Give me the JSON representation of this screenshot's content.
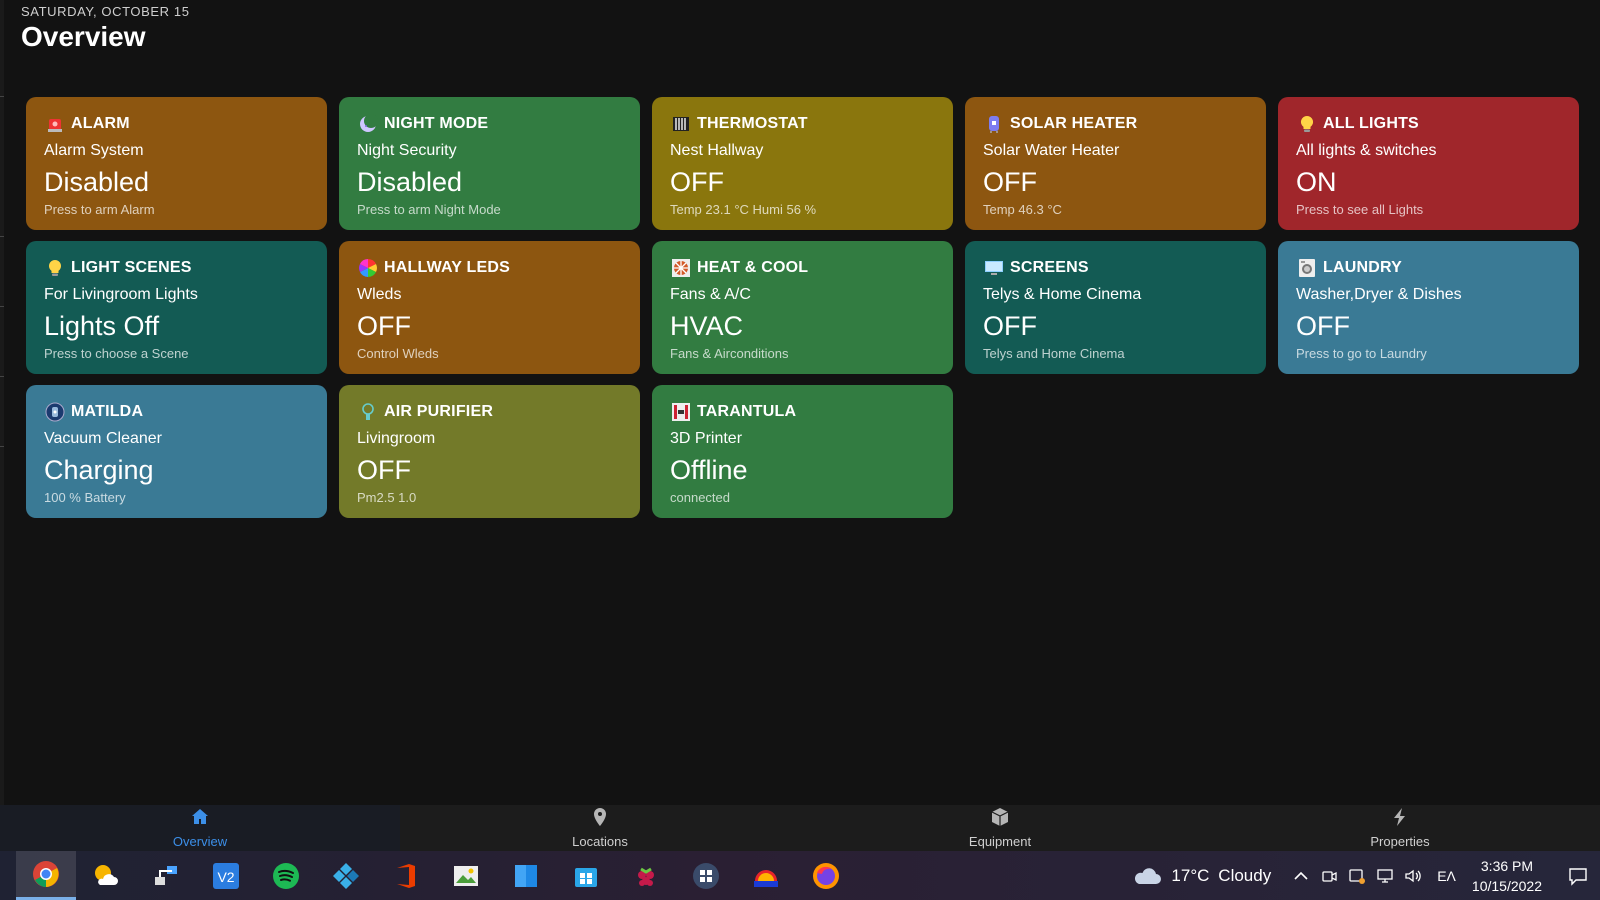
{
  "header": {
    "date": "SATURDAY, OCTOBER 15",
    "title": "Overview"
  },
  "cards": [
    {
      "id": "alarm",
      "color": "#8d5610",
      "icon": "alarm-icon",
      "name": "ALARM",
      "subtitle": "Alarm System",
      "state": "Disabled",
      "note": "Press to arm Alarm"
    },
    {
      "id": "night-mode",
      "color": "#327c41",
      "icon": "moon-icon",
      "name": "NIGHT MODE",
      "subtitle": "Night Security",
      "state": "Disabled",
      "note": "Press to arm Night Mode"
    },
    {
      "id": "thermostat",
      "color": "#8a760d",
      "icon": "radiator-icon",
      "name": "THERMOSTAT",
      "subtitle": "Nest Hallway",
      "state": "OFF",
      "note": "Temp 23.1 °C Humi 56 %"
    },
    {
      "id": "solar-heater",
      "color": "#8d5610",
      "icon": "water-heater-icon",
      "name": "SOLAR HEATER",
      "subtitle": "Solar Water Heater",
      "state": "OFF",
      "note": "Temp 46.3 °C"
    },
    {
      "id": "all-lights",
      "color": "#a0262b",
      "icon": "bulb-icon",
      "name": "ALL LIGHTS",
      "subtitle": "All lights & switches",
      "state": "ON",
      "note": "Press to see all Lights"
    },
    {
      "id": "light-scenes",
      "color": "#135b54",
      "icon": "bulb-icon",
      "name": "LIGHT SCENES",
      "subtitle": "For Livingroom Lights",
      "state": "Lights Off",
      "note": "Press to choose a Scene"
    },
    {
      "id": "hallway-leds",
      "color": "#8d5610",
      "icon": "color-wheel-icon",
      "name": "HALLWAY LEDS",
      "subtitle": "Wleds",
      "state": "OFF",
      "note": "Control Wleds"
    },
    {
      "id": "heat-cool",
      "color": "#327c41",
      "icon": "fan-icon",
      "name": "HEAT & COOL",
      "subtitle": "Fans & A/C",
      "state": "HVAC",
      "note": "Fans & Airconditions"
    },
    {
      "id": "screens",
      "color": "#135b54",
      "icon": "monitor-icon",
      "name": "SCREENS",
      "subtitle": "Telys & Home Cinema",
      "state": "OFF",
      "note": "Telys and Home Cinema"
    },
    {
      "id": "laundry",
      "color": "#3a7a95",
      "icon": "washer-icon",
      "name": "LAUNDRY",
      "subtitle": "Washer,Dryer & Dishes",
      "state": "OFF",
      "note": "Press to go to Laundry"
    },
    {
      "id": "matilda",
      "color": "#3a7a95",
      "icon": "robot-vacuum-icon",
      "name": "MATILDA",
      "subtitle": "Vacuum Cleaner",
      "state": "Charging",
      "note": "100 % Battery"
    },
    {
      "id": "air-purifier",
      "color": "#737a29",
      "icon": "air-purifier-icon",
      "name": "AIR PURIFIER",
      "subtitle": "Livingroom",
      "state": "OFF",
      "note": "Pm2.5 1.0"
    },
    {
      "id": "tarantula",
      "color": "#327c41",
      "icon": "printer-3d-icon",
      "name": "TARANTULA",
      "subtitle": "3D Printer",
      "state": "Offline",
      "note": "connected"
    }
  ],
  "nav": [
    {
      "id": "overview",
      "label": "Overview",
      "icon": "home-icon",
      "active": true
    },
    {
      "id": "locations",
      "label": "Locations",
      "icon": "map-pin-icon",
      "active": false
    },
    {
      "id": "equipment",
      "label": "Equipment",
      "icon": "box-icon",
      "active": false
    },
    {
      "id": "properties",
      "label": "Properties",
      "icon": "lightning-icon",
      "active": false
    }
  ],
  "taskbar": {
    "apps": [
      "chrome-icon",
      "weather-app-icon",
      "network-tool-icon",
      "vnc-viewer-icon",
      "spotify-icon",
      "kodi-icon",
      "office-icon",
      "image-viewer-icon",
      "file-manager-icon",
      "store-icon",
      "raspberry-pi-icon",
      "media-server-icon",
      "vpn-icon",
      "firefox-icon"
    ],
    "weather": {
      "temp": "17°C",
      "condition": "Cloudy"
    },
    "lang": "ΕΛ",
    "time": "3:36 PM",
    "date": "10/15/2022"
  },
  "colors": {
    "accent": "#3c8fe8",
    "background": "#121212"
  }
}
